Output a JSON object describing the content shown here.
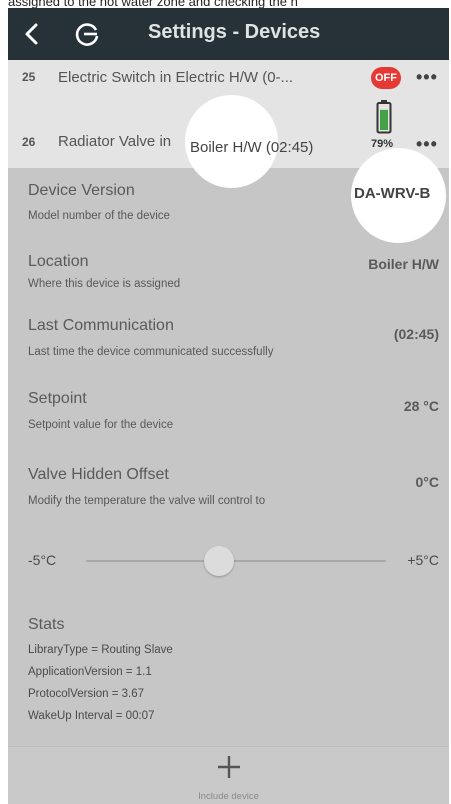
{
  "caption": {
    "text": "assigned to the hot water zone and checking the h"
  },
  "header": {
    "title": "Settings - Devices"
  },
  "devices": [
    {
      "number": "25",
      "name": "Electric Switch in Electric H/W (0-...",
      "status_badge": "OFF"
    },
    {
      "number": "26",
      "name_prefix": "Radiator Valve in ",
      "name_highlight": "Boiler H/W (02:45)",
      "battery_percent": "79%",
      "battery_level": 0.79
    }
  ],
  "more_label": "•••",
  "details": [
    {
      "title": "Device Version",
      "subtitle": "Model number of the device",
      "value": "DA-WRV-B"
    },
    {
      "title": "Location",
      "subtitle": "Where this device is assigned",
      "value": "Boiler H/W"
    },
    {
      "title": "Last Communication",
      "subtitle": "Last time the device communicated successfully",
      "value": "(02:45)"
    },
    {
      "title": "Setpoint",
      "subtitle": "Setpoint value for the device",
      "value": "28 °C"
    },
    {
      "title": "Valve Hidden Offset",
      "subtitle": "Modify the temperature the valve will control to",
      "value": "0°C"
    }
  ],
  "slider": {
    "min_label": "-5°C",
    "max_label": "+5°C",
    "value": 0
  },
  "stats": {
    "title": "Stats",
    "lines": [
      "LibraryType = Routing Slave",
      "ApplicationVersion = 1.1",
      "ProtocolVersion = 3.67",
      "WakeUp Interval = 00:07"
    ]
  },
  "footer": {
    "label": "Include device"
  },
  "colors": {
    "header_bg": "#263238",
    "off_badge": "#e53935",
    "battery_green": "#43a047"
  }
}
